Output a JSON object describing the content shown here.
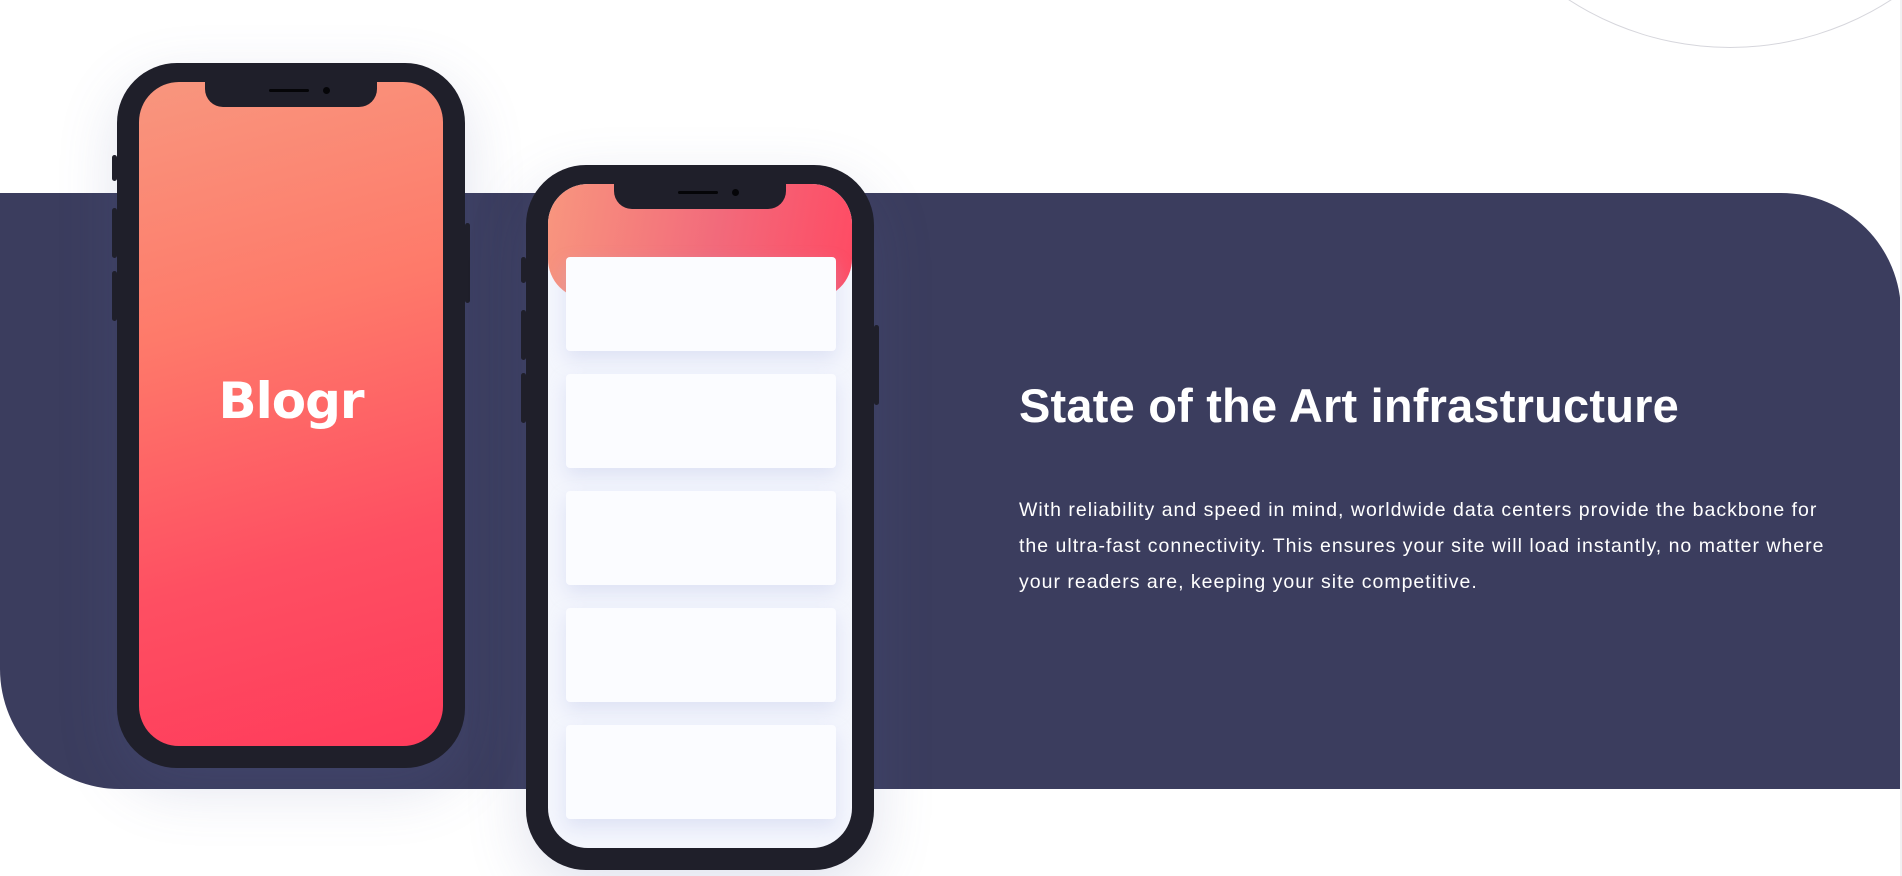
{
  "colors": {
    "background": "#ffffff",
    "band": "#3b3d5e",
    "phone_frame": "#1f1f2a",
    "gradient_start": "#f8967e",
    "gradient_end": "#ff3b5b",
    "text": "#ffffff"
  },
  "mockups": {
    "left_phone": {
      "brand_name": "Blogr"
    },
    "right_phone": {
      "card_count": 5
    }
  },
  "section": {
    "title": "State of the Art infrastructure",
    "body": "With reliability and speed in mind, worldwide data centers provide the backbone for the ultra-fast connectivity. This ensures your site will load instantly, no matter where your readers are, keeping your site competitive."
  }
}
